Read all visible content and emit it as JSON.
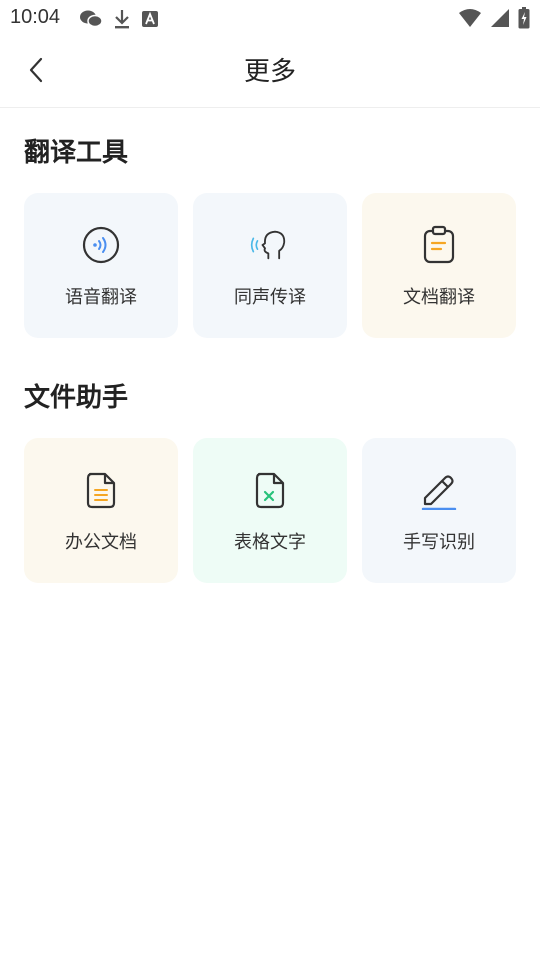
{
  "status_bar": {
    "time": "10:04",
    "left_icons": [
      "wechat-icon",
      "download-icon",
      "a-icon"
    ],
    "right_icons": [
      "wifi-icon",
      "signal-icon",
      "battery-icon"
    ]
  },
  "header": {
    "title": "更多",
    "back_icon": "chevron-left-icon"
  },
  "sections": [
    {
      "title": "翻译工具",
      "items": [
        {
          "label": "语音翻译",
          "icon": "voice-translate-icon",
          "bg": "#f3f7fb"
        },
        {
          "label": "同声传译",
          "icon": "simultaneous-interpret-icon",
          "bg": "#f3f7fb"
        },
        {
          "label": "文档翻译",
          "icon": "document-translate-icon",
          "bg": "#fcf8ee"
        }
      ]
    },
    {
      "title": "文件助手",
      "items": [
        {
          "label": "办公文档",
          "icon": "office-document-icon",
          "bg": "#fcf8ee"
        },
        {
          "label": "表格文字",
          "icon": "spreadsheet-text-icon",
          "bg": "#eefcf6"
        },
        {
          "label": "手写识别",
          "icon": "handwriting-icon",
          "bg": "#f3f7fb"
        }
      ]
    }
  ],
  "colors": {
    "accent_blue": "#4a8ef0",
    "accent_orange": "#f5a623",
    "accent_green": "#27c27a",
    "icon_stroke": "#333333"
  }
}
